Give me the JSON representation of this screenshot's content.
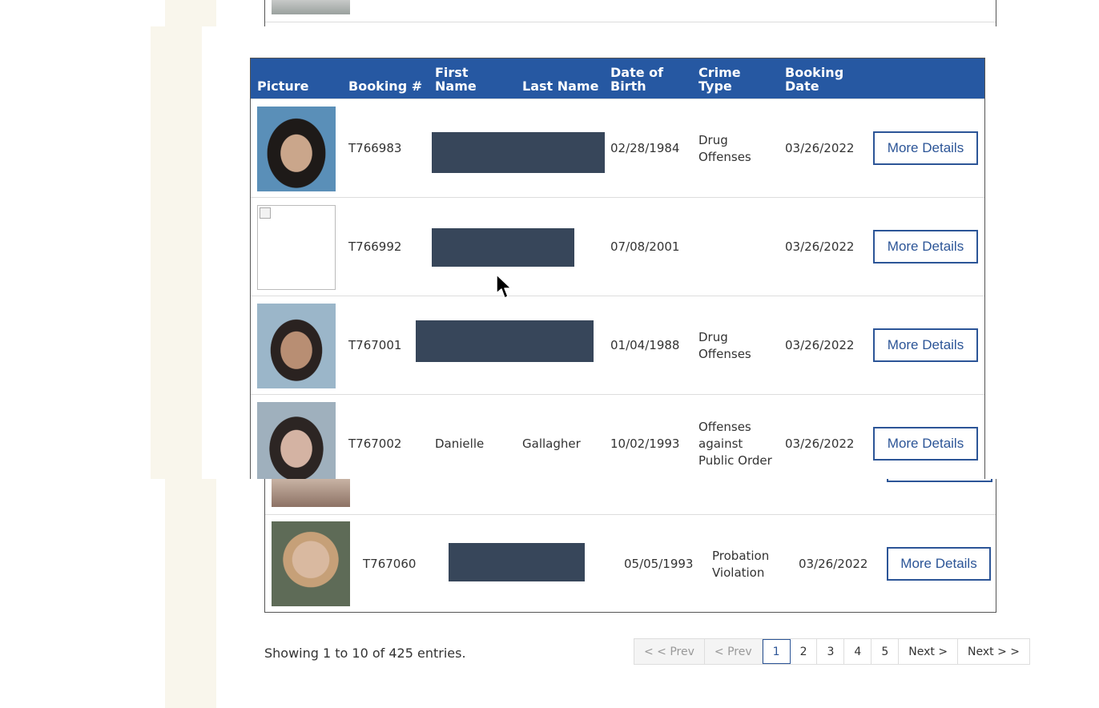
{
  "table": {
    "headers": {
      "picture": "Picture",
      "booking": "Booking #",
      "first_name": "First\nName",
      "last_name": "Last Name",
      "dob": "Date of\nBirth",
      "crime_type": "Crime\nType",
      "booking_date": "Booking\nDate"
    },
    "rows": [
      {
        "booking": "T766983",
        "first_name": "",
        "last_name": "",
        "dob": "02/28/1984",
        "crime": "Drug\nOffenses",
        "booking_date": "03/26/2022",
        "button": "More Details"
      },
      {
        "booking": "T766992",
        "first_name": "",
        "last_name": "",
        "dob": "07/08/2001",
        "crime": "",
        "booking_date": "03/26/2022",
        "button": "More Details"
      },
      {
        "booking": "T767001",
        "first_name": "",
        "last_name": "",
        "dob": "01/04/1988",
        "crime": "Drug\nOffenses",
        "booking_date": "03/26/2022",
        "button": "More Details"
      },
      {
        "booking": "T767002",
        "first_name": "Danielle",
        "last_name": "Gallagher",
        "dob": "10/02/1993",
        "crime": "Offenses\nagainst\nPublic Order",
        "booking_date": "03/26/2022",
        "button": "More Details"
      }
    ],
    "background_row": {
      "booking": "T767060",
      "dob": "05/05/1993",
      "crime": "Probation\nViolation",
      "booking_date": "03/26/2022",
      "button": "More Details"
    }
  },
  "footer": {
    "showing": "Showing 1 to 10 of 425 entries.",
    "pagination": [
      "< < Prev",
      "< Prev",
      "1",
      "2",
      "3",
      "4",
      "5",
      "Next >",
      "Next > >"
    ],
    "current_page": "1"
  },
  "colors": {
    "header_bg": "#2658a2",
    "button_border": "#2c5597",
    "redaction": "#37465a",
    "side_stripe": "#f9f6ec"
  }
}
